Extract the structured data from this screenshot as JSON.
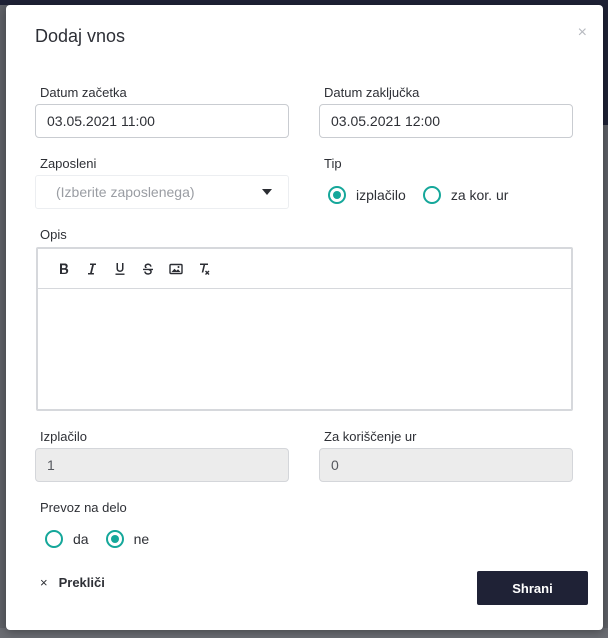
{
  "modal": {
    "title": "Dodaj vnos",
    "close_icon": "×"
  },
  "fields": {
    "start_date": {
      "label": "Datum začetka",
      "value": "03.05.2021 11:00"
    },
    "end_date": {
      "label": "Datum zaključka",
      "value": "03.05.2021 12:00"
    },
    "employee": {
      "label": "Zaposleni",
      "placeholder": "(Izberite zaposlenega)"
    },
    "type": {
      "label": "Tip",
      "options": [
        {
          "label": "izplačilo",
          "checked": true
        },
        {
          "label": "za kor. ur",
          "checked": false
        }
      ]
    },
    "description": {
      "label": "Opis"
    },
    "payout": {
      "label": "Izplačilo",
      "value": "1"
    },
    "hours_usage": {
      "label": "Za koriščenje ur",
      "value": "0"
    },
    "commute": {
      "label": "Prevoz na delo",
      "options": [
        {
          "label": "da",
          "checked": false
        },
        {
          "label": "ne",
          "checked": true
        }
      ]
    }
  },
  "toolbar": {
    "icons": [
      "bold-icon",
      "italic-icon",
      "underline-icon",
      "strikethrough-icon",
      "image-icon",
      "clear-format-icon"
    ]
  },
  "footer": {
    "cancel_icon": "×",
    "cancel_label": "Prekliči",
    "save_label": "Shrani"
  },
  "colors": {
    "accent": "#15a79a",
    "primary_button": "#1f2236",
    "disabled_input": "#ececec"
  }
}
